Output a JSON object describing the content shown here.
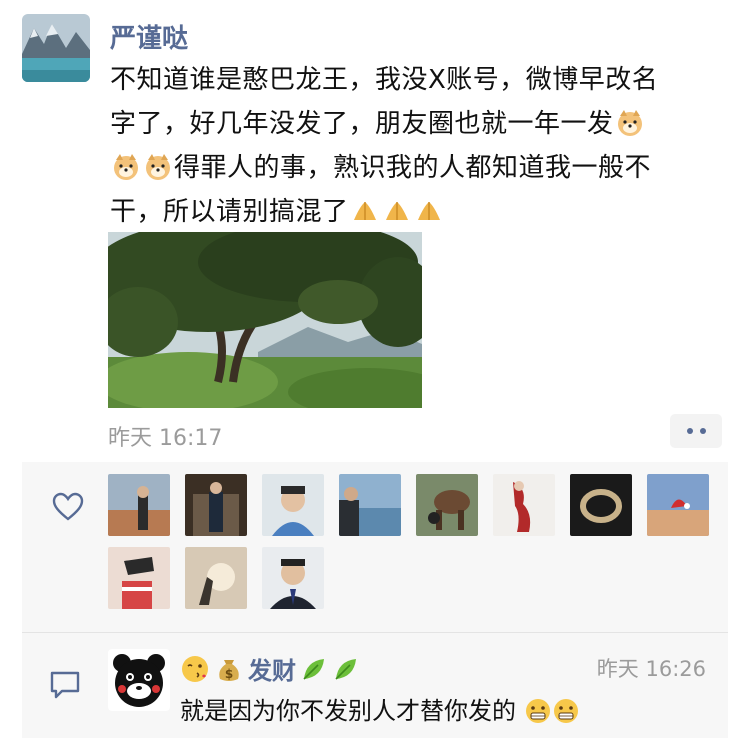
{
  "post": {
    "author": "严谨哒",
    "lines": [
      [
        "不知道谁是憨巴龙王，我没Ⅹ账号，微博早改名"
      ],
      [
        "字了，好几年没发了，朋友圈也就一年一发",
        "doge"
      ],
      [
        "doge",
        "doge",
        "得罪人的事，熟识我的人都知道我一般不"
      ],
      [
        "干，所以请别搞混了",
        "pray",
        "pray",
        "pray"
      ]
    ],
    "time": "昨天 16:17"
  },
  "comment": {
    "name": "发财",
    "time": "昨天 16:26",
    "text": "就是因为你不发别人才替你发的",
    "name_emojis": [
      "kiss-face",
      "money-bag"
    ],
    "name_suffix": [
      "leaf",
      "leaf"
    ],
    "text_emojis": [
      "grimace",
      "grimace"
    ]
  },
  "icons": {
    "like": "heart-outline-icon",
    "comment": "comment-bubble-icon",
    "more": "more-dots-icon"
  },
  "colors": {
    "name_blue": "#576b95",
    "panel_bg": "#f7f7f7",
    "time_gray": "#9b9b9b"
  }
}
